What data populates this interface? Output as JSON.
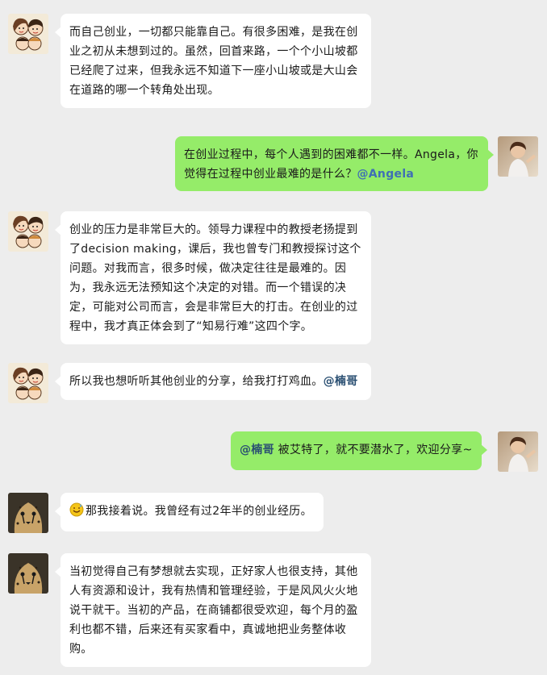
{
  "colors": {
    "background": "#ededed",
    "self_bubble": "#95ec69",
    "other_bubble": "#ffffff",
    "mention_blue": "#3f6fb5"
  },
  "messages": [
    {
      "side": "left",
      "avatar": "couple-cartoon-avatar",
      "text": "而自己创业，一切都只能靠自己。有很多困难，是我在创业之初从未想到过的。虽然，回首来路，一个个小山坡都已经爬了过来，但我永远不知道下一座小山坡或是大山会在道路的哪一个转角处出现。",
      "mention": ""
    },
    {
      "side": "right",
      "avatar": "child-photo-avatar",
      "text": "在创业过程中，每个人遇到的困难都不一样。Angela，你觉得在过程中创业最难的是什么？",
      "mention": "@Angela"
    },
    {
      "side": "left",
      "avatar": "couple-cartoon-avatar",
      "text": "创业的压力是非常巨大的。领导力课程中的教授老扬提到了decision making，课后，我也曾专门和教授探讨这个问题。对我而言，很多时候，做决定往往是最难的。因为，我永远无法预知这个决定的对错。而一个错误的决定，可能对公司而言，会是非常巨大的打击。在创业的过程中，我才真正体会到了“知易行难”这四个字。",
      "mention": ""
    },
    {
      "side": "left",
      "avatar": "couple-cartoon-avatar",
      "text": "所以我也想听听其他创业的分享，给我打打鸡血。",
      "mention": "@楠哥"
    },
    {
      "side": "right",
      "avatar": "child-photo-avatar",
      "mention_prefix": "@楠哥",
      "text": " 被艾特了，就不要潜水了，欢迎分享~",
      "mention": ""
    },
    {
      "side": "left",
      "avatar": "cheetah-avatar",
      "emoji": "sweat-smile-emoji",
      "text": "那我接着说。我曾经有过2年半的创业经历。",
      "mention": ""
    },
    {
      "side": "left",
      "avatar": "cheetah-avatar",
      "text": "当初觉得自己有梦想就去实现，正好家人也很支持，其他人有资源和设计，我有热情和管理经验，于是风风火火地说干就干。当初的产品，在商铺都很受欢迎，每个月的盈利也都不错，后来还有买家看中，真诚地把业务整体收购。",
      "mention": ""
    }
  ]
}
